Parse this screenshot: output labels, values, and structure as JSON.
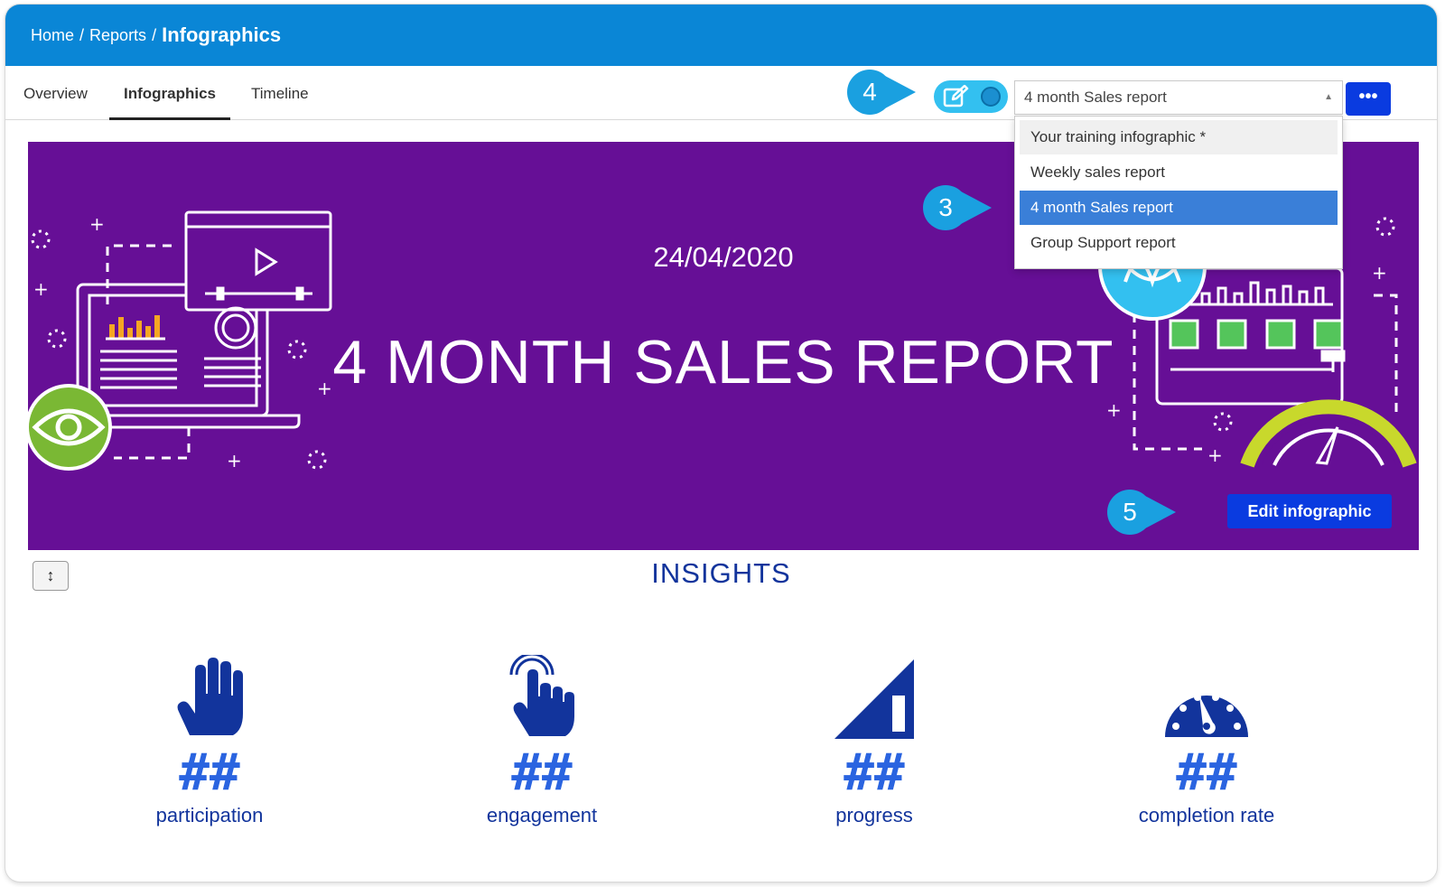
{
  "breadcrumb": {
    "items": [
      "Home",
      "Reports"
    ],
    "current": "Infographics"
  },
  "tabs": [
    {
      "label": "Overview",
      "active": false
    },
    {
      "label": "Infographics",
      "active": true
    },
    {
      "label": "Timeline",
      "active": false
    }
  ],
  "markers": {
    "edit_toggle": "4",
    "dropdown_option": "3",
    "edit_button": "5"
  },
  "report_select": {
    "value": "4 month Sales report",
    "options": [
      "Your training infographic *",
      "Weekly sales report",
      "4 month Sales report",
      "Group Support report"
    ],
    "selected_index": 2
  },
  "more_button": "•••",
  "banner": {
    "date": "24/04/2020",
    "title": "4 MONTH SALES REPORT",
    "edit_button": "Edit infographic",
    "color": "#660f96"
  },
  "insights": {
    "title": "INSIGHTS",
    "resize_icon": "↕",
    "stats": [
      {
        "value": "##",
        "label": "participation",
        "icon": "raised-hand-icon"
      },
      {
        "value": "##",
        "label": "engagement",
        "icon": "tap-finger-icon"
      },
      {
        "value": "##",
        "label": "progress",
        "icon": "progress-triangle-icon"
      },
      {
        "value": "##",
        "label": "completion rate",
        "icon": "speedometer-icon"
      }
    ]
  },
  "colors": {
    "topbar": "#0a86d6",
    "primary_button": "#0a3be0",
    "marker": "#1aa0e0",
    "insight_text": "#12349c",
    "insight_value": "#2a64e0"
  }
}
